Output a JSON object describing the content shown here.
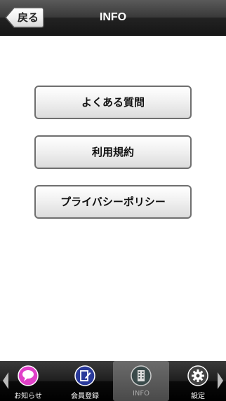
{
  "header": {
    "title": "INFO",
    "back_label": "戻る"
  },
  "menu": [
    {
      "label": "よくある質問"
    },
    {
      "label": "利用規約"
    },
    {
      "label": "プライバシーポリシー"
    }
  ],
  "tabbar": {
    "tabs": [
      {
        "label": "お知らせ",
        "icon": "speech-bubble-icon",
        "color": "#e040c8"
      },
      {
        "label": "会員登録",
        "icon": "edit-document-icon",
        "color": "#2a3a9a"
      },
      {
        "label": "INFO",
        "icon": "building-icon",
        "color": "#3a4a4a",
        "active": true
      },
      {
        "label": "設定",
        "icon": "gear-icon",
        "color": "#444444"
      }
    ]
  }
}
